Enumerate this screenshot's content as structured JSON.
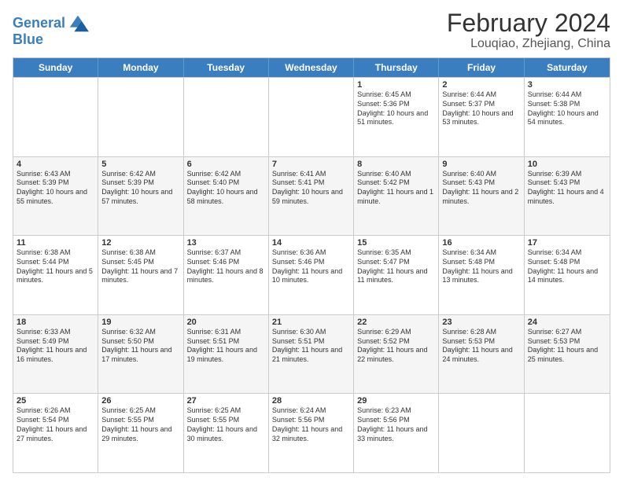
{
  "header": {
    "logo_line1": "General",
    "logo_line2": "Blue",
    "title": "February 2024",
    "subtitle": "Louqiao, Zhejiang, China"
  },
  "days_of_week": [
    "Sunday",
    "Monday",
    "Tuesday",
    "Wednesday",
    "Thursday",
    "Friday",
    "Saturday"
  ],
  "rows": [
    [
      {
        "day": "",
        "empty": true
      },
      {
        "day": "",
        "empty": true
      },
      {
        "day": "",
        "empty": true
      },
      {
        "day": "",
        "empty": true
      },
      {
        "day": "1",
        "info": "Sunrise: 6:45 AM\nSunset: 5:36 PM\nDaylight: 10 hours and 51 minutes."
      },
      {
        "day": "2",
        "info": "Sunrise: 6:44 AM\nSunset: 5:37 PM\nDaylight: 10 hours and 53 minutes."
      },
      {
        "day": "3",
        "info": "Sunrise: 6:44 AM\nSunset: 5:38 PM\nDaylight: 10 hours and 54 minutes."
      }
    ],
    [
      {
        "day": "4",
        "info": "Sunrise: 6:43 AM\nSunset: 5:39 PM\nDaylight: 10 hours and 55 minutes."
      },
      {
        "day": "5",
        "info": "Sunrise: 6:42 AM\nSunset: 5:39 PM\nDaylight: 10 hours and 57 minutes."
      },
      {
        "day": "6",
        "info": "Sunrise: 6:42 AM\nSunset: 5:40 PM\nDaylight: 10 hours and 58 minutes."
      },
      {
        "day": "7",
        "info": "Sunrise: 6:41 AM\nSunset: 5:41 PM\nDaylight: 10 hours and 59 minutes."
      },
      {
        "day": "8",
        "info": "Sunrise: 6:40 AM\nSunset: 5:42 PM\nDaylight: 11 hours and 1 minute."
      },
      {
        "day": "9",
        "info": "Sunrise: 6:40 AM\nSunset: 5:43 PM\nDaylight: 11 hours and 2 minutes."
      },
      {
        "day": "10",
        "info": "Sunrise: 6:39 AM\nSunset: 5:43 PM\nDaylight: 11 hours and 4 minutes."
      }
    ],
    [
      {
        "day": "11",
        "info": "Sunrise: 6:38 AM\nSunset: 5:44 PM\nDaylight: 11 hours and 5 minutes."
      },
      {
        "day": "12",
        "info": "Sunrise: 6:38 AM\nSunset: 5:45 PM\nDaylight: 11 hours and 7 minutes."
      },
      {
        "day": "13",
        "info": "Sunrise: 6:37 AM\nSunset: 5:46 PM\nDaylight: 11 hours and 8 minutes."
      },
      {
        "day": "14",
        "info": "Sunrise: 6:36 AM\nSunset: 5:46 PM\nDaylight: 11 hours and 10 minutes."
      },
      {
        "day": "15",
        "info": "Sunrise: 6:35 AM\nSunset: 5:47 PM\nDaylight: 11 hours and 11 minutes."
      },
      {
        "day": "16",
        "info": "Sunrise: 6:34 AM\nSunset: 5:48 PM\nDaylight: 11 hours and 13 minutes."
      },
      {
        "day": "17",
        "info": "Sunrise: 6:34 AM\nSunset: 5:48 PM\nDaylight: 11 hours and 14 minutes."
      }
    ],
    [
      {
        "day": "18",
        "info": "Sunrise: 6:33 AM\nSunset: 5:49 PM\nDaylight: 11 hours and 16 minutes."
      },
      {
        "day": "19",
        "info": "Sunrise: 6:32 AM\nSunset: 5:50 PM\nDaylight: 11 hours and 17 minutes."
      },
      {
        "day": "20",
        "info": "Sunrise: 6:31 AM\nSunset: 5:51 PM\nDaylight: 11 hours and 19 minutes."
      },
      {
        "day": "21",
        "info": "Sunrise: 6:30 AM\nSunset: 5:51 PM\nDaylight: 11 hours and 21 minutes."
      },
      {
        "day": "22",
        "info": "Sunrise: 6:29 AM\nSunset: 5:52 PM\nDaylight: 11 hours and 22 minutes."
      },
      {
        "day": "23",
        "info": "Sunrise: 6:28 AM\nSunset: 5:53 PM\nDaylight: 11 hours and 24 minutes."
      },
      {
        "day": "24",
        "info": "Sunrise: 6:27 AM\nSunset: 5:53 PM\nDaylight: 11 hours and 25 minutes."
      }
    ],
    [
      {
        "day": "25",
        "info": "Sunrise: 6:26 AM\nSunset: 5:54 PM\nDaylight: 11 hours and 27 minutes."
      },
      {
        "day": "26",
        "info": "Sunrise: 6:25 AM\nSunset: 5:55 PM\nDaylight: 11 hours and 29 minutes."
      },
      {
        "day": "27",
        "info": "Sunrise: 6:25 AM\nSunset: 5:55 PM\nDaylight: 11 hours and 30 minutes."
      },
      {
        "day": "28",
        "info": "Sunrise: 6:24 AM\nSunset: 5:56 PM\nDaylight: 11 hours and 32 minutes."
      },
      {
        "day": "29",
        "info": "Sunrise: 6:23 AM\nSunset: 5:56 PM\nDaylight: 11 hours and 33 minutes."
      },
      {
        "day": "",
        "empty": true
      },
      {
        "day": "",
        "empty": true
      }
    ]
  ]
}
